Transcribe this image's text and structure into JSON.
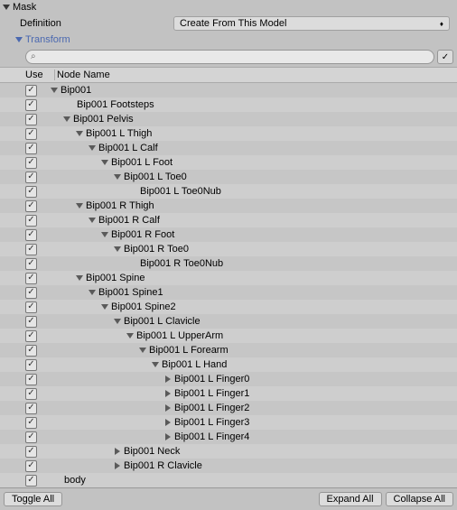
{
  "mask": {
    "title": "Mask",
    "definition_label": "Definition",
    "definition_value": "Create From This Model",
    "transform_label": "Transform",
    "search_placeholder": "",
    "columns": {
      "use": "Use",
      "node": "Node Name"
    },
    "buttons": {
      "toggle_all": "Toggle All",
      "expand_all": "Expand All",
      "collapse_all": "Collapse All"
    }
  },
  "tree": [
    {
      "depth": 0,
      "fold": "open",
      "label": "Bip001",
      "checked": true
    },
    {
      "depth": 1,
      "fold": "none",
      "label": "Bip001 Footsteps",
      "checked": true
    },
    {
      "depth": 1,
      "fold": "open",
      "label": "Bip001 Pelvis",
      "checked": true
    },
    {
      "depth": 2,
      "fold": "open",
      "label": "Bip001 L Thigh",
      "checked": true
    },
    {
      "depth": 3,
      "fold": "open",
      "label": "Bip001 L Calf",
      "checked": true
    },
    {
      "depth": 4,
      "fold": "open",
      "label": "Bip001 L Foot",
      "checked": true
    },
    {
      "depth": 5,
      "fold": "open",
      "label": "Bip001 L Toe0",
      "checked": true
    },
    {
      "depth": 6,
      "fold": "none",
      "label": "Bip001 L Toe0Nub",
      "checked": true
    },
    {
      "depth": 2,
      "fold": "open",
      "label": "Bip001 R Thigh",
      "checked": true
    },
    {
      "depth": 3,
      "fold": "open",
      "label": "Bip001 R Calf",
      "checked": true
    },
    {
      "depth": 4,
      "fold": "open",
      "label": "Bip001 R Foot",
      "checked": true
    },
    {
      "depth": 5,
      "fold": "open",
      "label": "Bip001 R Toe0",
      "checked": true
    },
    {
      "depth": 6,
      "fold": "none",
      "label": "Bip001 R Toe0Nub",
      "checked": true
    },
    {
      "depth": 2,
      "fold": "open",
      "label": "Bip001 Spine",
      "checked": true
    },
    {
      "depth": 3,
      "fold": "open",
      "label": "Bip001 Spine1",
      "checked": true
    },
    {
      "depth": 4,
      "fold": "open",
      "label": "Bip001 Spine2",
      "checked": true
    },
    {
      "depth": 5,
      "fold": "open",
      "label": "Bip001 L Clavicle",
      "checked": true
    },
    {
      "depth": 6,
      "fold": "open",
      "label": "Bip001 L UpperArm",
      "checked": true
    },
    {
      "depth": 7,
      "fold": "open",
      "label": "Bip001 L Forearm",
      "checked": true
    },
    {
      "depth": 8,
      "fold": "open",
      "label": "Bip001 L Hand",
      "checked": true
    },
    {
      "depth": 9,
      "fold": "closed",
      "label": "Bip001 L Finger0",
      "checked": true
    },
    {
      "depth": 9,
      "fold": "closed",
      "label": "Bip001 L Finger1",
      "checked": true
    },
    {
      "depth": 9,
      "fold": "closed",
      "label": "Bip001 L Finger2",
      "checked": true
    },
    {
      "depth": 9,
      "fold": "closed",
      "label": "Bip001 L Finger3",
      "checked": true
    },
    {
      "depth": 9,
      "fold": "closed",
      "label": "Bip001 L Finger4",
      "checked": true
    },
    {
      "depth": 5,
      "fold": "closed",
      "label": "Bip001 Neck",
      "checked": true
    },
    {
      "depth": 5,
      "fold": "closed",
      "label": "Bip001 R Clavicle",
      "checked": true
    },
    {
      "depth": 0,
      "fold": "none",
      "label": "body",
      "checked": true
    }
  ]
}
